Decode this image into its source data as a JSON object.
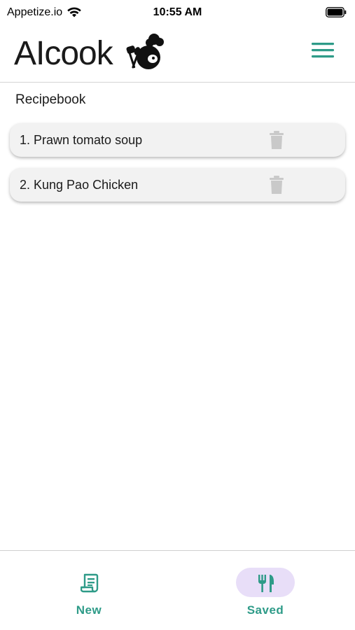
{
  "status_bar": {
    "carrier": "Appetize.io",
    "time": "10:55 AM"
  },
  "header": {
    "logo_text": "AIcook",
    "menu_icon": "hamburger-menu-icon"
  },
  "recipebook": {
    "title": "Recipebook",
    "recipes": [
      {
        "label": "1. Prawn tomato soup"
      },
      {
        "label": "2. Kung Pao Chicken"
      }
    ],
    "delete_icon": "trash-icon"
  },
  "bottom_nav": {
    "items": [
      {
        "label": "New",
        "icon": "receipt-icon",
        "active": false
      },
      {
        "label": "Saved",
        "icon": "restaurant-icon",
        "active": true
      }
    ]
  },
  "colors": {
    "accent": "#2e9b88",
    "active_pill": "#e8def8",
    "card_bg": "#f2f2f2",
    "trash": "#c9c9c9"
  }
}
